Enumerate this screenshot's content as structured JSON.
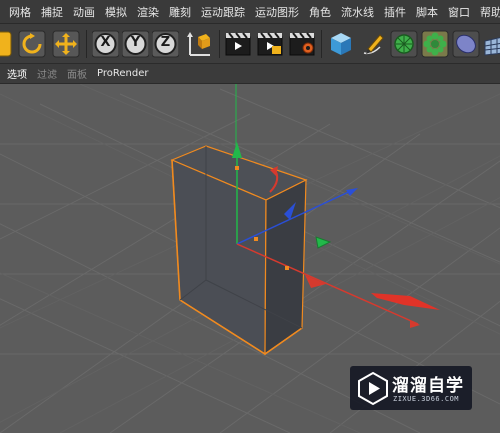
{
  "menu": [
    "网格",
    "捕捉",
    "动画",
    "模拟",
    "渲染",
    "雕刻",
    "运动跟踪",
    "运动图形",
    "角色",
    "流水线",
    "插件",
    "脚本",
    "窗口",
    "帮助"
  ],
  "toolbar": {
    "tools": [
      "move-icon",
      "rotate-icon",
      "scale-icon",
      "x-axis-lock",
      "y-axis-lock",
      "z-axis-lock",
      "coordinate-system",
      "render-view",
      "render-to-picture-viewer",
      "render-settings",
      "cube-object",
      "pen-spline",
      "subdivision-generator",
      "cloner-array",
      "deformer",
      "floor-grid"
    ],
    "axis_labels": [
      "X",
      "Y",
      "Z"
    ]
  },
  "subbar": {
    "items": [
      {
        "label": "选项",
        "state": "active"
      },
      {
        "label": "过滤",
        "state": "dim"
      },
      {
        "label": "面板",
        "state": "dim"
      },
      {
        "label": "ProRender",
        "state": "accent"
      }
    ]
  },
  "viewport": {
    "background": "#5b5b5b",
    "grid_color": "#6a6a6a",
    "object": "box",
    "selection_color": "#f08a1f",
    "axis_colors": {
      "x": "#d63a2e",
      "y": "#22b84a",
      "z": "#2a4fd6"
    }
  },
  "watermark": {
    "title": "溜溜自学",
    "url": "ZIXUE.3D66.COM",
    "logo": "play-icon"
  }
}
